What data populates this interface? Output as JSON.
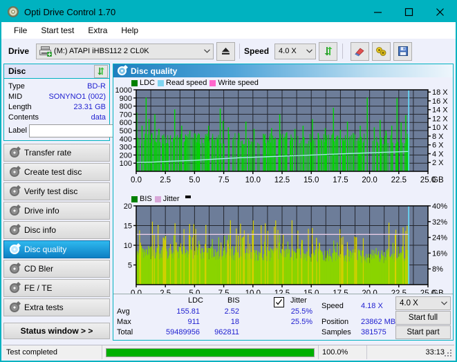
{
  "window": {
    "title": "Opti Drive Control 1.70",
    "icon": "disc-icon",
    "minimize": "minimize-icon",
    "maximize": "maximize-icon",
    "close": "close-icon",
    "accent_color": "#00b2c0"
  },
  "menu": {
    "items": [
      {
        "label": "File"
      },
      {
        "label": "Start test"
      },
      {
        "label": "Extra"
      },
      {
        "label": "Help"
      }
    ]
  },
  "toolbar": {
    "drive_label": "Drive",
    "drive_value": "(M:)   ATAPI iHBS112  2 CL0K",
    "eject_icon": "eject-icon",
    "speed_label": "Speed",
    "speed_value": "4.0 X",
    "refresh_icon": "refresh-icon",
    "erase_icon": "eraser-icon",
    "tools_icon": "plug-icon",
    "save_icon": "floppy-save-icon"
  },
  "disc_panel": {
    "title": "Disc",
    "refresh_icon": "refresh-icon",
    "rows": [
      {
        "key": "Type",
        "value": "BD-R"
      },
      {
        "key": "MID",
        "value": "SONYNO1 (002)"
      },
      {
        "key": "Length",
        "value": "23.31 GB"
      },
      {
        "key": "Contents",
        "value": "data"
      }
    ],
    "label_key": "Label",
    "label_value": "",
    "label_placeholder": "",
    "disc_button_icon": "cd-icon"
  },
  "nav": {
    "items": [
      {
        "label": "Transfer rate",
        "active": false
      },
      {
        "label": "Create test disc",
        "active": false
      },
      {
        "label": "Verify test disc",
        "active": false
      },
      {
        "label": "Drive info",
        "active": false
      },
      {
        "label": "Disc info",
        "active": false
      },
      {
        "label": "Disc quality",
        "active": true
      },
      {
        "label": "CD Bler",
        "active": false
      },
      {
        "label": "FE / TE",
        "active": false
      },
      {
        "label": "Extra tests",
        "active": false
      }
    ],
    "status_window": "Status window > >"
  },
  "panel": {
    "title": "Disc quality",
    "icon": "disc-quality-icon"
  },
  "chart_data": [
    {
      "type": "area",
      "id": "ldc-chart",
      "title": "",
      "legend": [
        {
          "label": "LDC",
          "color": "#008000"
        },
        {
          "label": "Read speed",
          "color": "#7fd4f0"
        },
        {
          "label": "Write speed",
          "color": "#ff66cc"
        }
      ],
      "legend_position": "top-left",
      "xlabel": "GB",
      "x_ticks": [
        "0.0",
        "2.5",
        "5.0",
        "7.5",
        "10.0",
        "12.5",
        "15.0",
        "17.5",
        "20.0",
        "22.5",
        "25.0"
      ],
      "xlim": [
        0,
        25
      ],
      "ylabel_left": "",
      "y_ticks_left": [
        "1000",
        "900",
        "800",
        "700",
        "600",
        "500",
        "400",
        "300",
        "200",
        "100"
      ],
      "ylim_left": [
        0,
        1000
      ],
      "ylabel_right": "",
      "y_ticks_right": [
        "18 X",
        "16 X",
        "14 X",
        "12 X",
        "10 X",
        "8 X",
        "6 X",
        "4 X",
        "2 X"
      ],
      "ylim_right": [
        0,
        18.5
      ],
      "grid": true,
      "plot_bg": "#6d7d99",
      "data_end_x": 23.4,
      "series": [
        {
          "name": "LDC",
          "color": "#00d400",
          "type": "area",
          "baseline_values": [
            400,
            390,
            350,
            330,
            320,
            310,
            305,
            300,
            300,
            298,
            296,
            295,
            292,
            290,
            290,
            288,
            288,
            287,
            286,
            286,
            285,
            286,
            287,
            288,
            289,
            290,
            291,
            292,
            293,
            294,
            295,
            296,
            297,
            298,
            299,
            300,
            301,
            302,
            303,
            305,
            307,
            309,
            311,
            313,
            315,
            317,
            319,
            321,
            323,
            325
          ],
          "peaks": [
            {
              "x": 0.05,
              "y": 720
            },
            {
              "x": 0.5,
              "y": 560
            },
            {
              "x": 0.85,
              "y": 905
            },
            {
              "x": 1.1,
              "y": 640
            },
            {
              "x": 1.35,
              "y": 470
            },
            {
              "x": 1.6,
              "y": 700
            },
            {
              "x": 1.95,
              "y": 520
            },
            {
              "x": 2.25,
              "y": 440
            },
            {
              "x": 3.3,
              "y": 760
            },
            {
              "x": 3.9,
              "y": 560
            },
            {
              "x": 4.6,
              "y": 500
            },
            {
              "x": 5.4,
              "y": 455
            },
            {
              "x": 6.2,
              "y": 560
            },
            {
              "x": 6.55,
              "y": 430
            },
            {
              "x": 7.2,
              "y": 770
            },
            {
              "x": 7.45,
              "y": 620
            },
            {
              "x": 7.9,
              "y": 540
            },
            {
              "x": 8.8,
              "y": 470
            },
            {
              "x": 9.4,
              "y": 610
            },
            {
              "x": 10.1,
              "y": 520
            },
            {
              "x": 10.9,
              "y": 460
            },
            {
              "x": 11.6,
              "y": 530
            },
            {
              "x": 12.3,
              "y": 700
            },
            {
              "x": 12.9,
              "y": 480
            },
            {
              "x": 13.6,
              "y": 520
            },
            {
              "x": 14.3,
              "y": 560
            },
            {
              "x": 15.1,
              "y": 640
            },
            {
              "x": 15.6,
              "y": 470
            },
            {
              "x": 16.2,
              "y": 530
            },
            {
              "x": 16.9,
              "y": 780
            },
            {
              "x": 17.5,
              "y": 510
            },
            {
              "x": 18.1,
              "y": 610
            },
            {
              "x": 18.6,
              "y": 470
            },
            {
              "x": 19.2,
              "y": 560
            },
            {
              "x": 19.8,
              "y": 905
            },
            {
              "x": 20.4,
              "y": 540
            },
            {
              "x": 20.9,
              "y": 630
            },
            {
              "x": 21.4,
              "y": 500
            },
            {
              "x": 21.9,
              "y": 560
            },
            {
              "x": 22.35,
              "y": 900
            },
            {
              "x": 22.7,
              "y": 600
            },
            {
              "x": 23.1,
              "y": 690
            }
          ]
        },
        {
          "name": "Read speed",
          "color": "#9ff0e0",
          "type": "line",
          "points": [
            [
              0.0,
              2.0
            ],
            [
              1.5,
              2.1
            ],
            [
              3.0,
              2.3
            ],
            [
              5.0,
              2.5
            ],
            [
              7.0,
              2.8
            ],
            [
              9.0,
              3.1
            ],
            [
              11.0,
              3.3
            ],
            [
              13.0,
              3.5
            ],
            [
              15.0,
              3.7
            ],
            [
              17.0,
              3.9
            ],
            [
              19.0,
              4.1
            ],
            [
              21.0,
              4.3
            ],
            [
              23.3,
              4.5
            ]
          ]
        },
        {
          "name": "Write speed",
          "color": "#ff66cc",
          "type": "line",
          "points": []
        }
      ],
      "cursor_line": {
        "x": 23.35,
        "color": "#66e0ff"
      }
    },
    {
      "type": "bar",
      "id": "bis-jitter-chart",
      "title": "",
      "legend": [
        {
          "label": "BIS",
          "color": "#008000"
        },
        {
          "label": "Jitter",
          "color": "#d8a8d8"
        }
      ],
      "legend_position": "top-left",
      "xlabel": "GB",
      "x_ticks": [
        "0.0",
        "2.5",
        "5.0",
        "7.5",
        "10.0",
        "12.5",
        "15.0",
        "17.5",
        "20.0",
        "22.5",
        "25.0"
      ],
      "xlim": [
        0,
        25
      ],
      "y_ticks_left": [
        "20",
        "15",
        "10",
        "5"
      ],
      "ylim_left": [
        0,
        20
      ],
      "y_ticks_right": [
        "40%",
        "32%",
        "24%",
        "16%",
        "8%"
      ],
      "ylim_right": [
        0,
        40
      ],
      "grid": true,
      "plot_bg": "#6d7d99",
      "data_end_x": 23.4,
      "series": [
        {
          "name": "BIS",
          "color": "#7fd000",
          "type": "bar",
          "avg_level": 9.5,
          "max_level": 16
        },
        {
          "name": "Jitter",
          "color": "#e8d0e8",
          "type": "line",
          "level_pct": 25.5
        }
      ],
      "cursor_line": {
        "x": 23.35,
        "color": "#66e0ff"
      }
    }
  ],
  "stats": {
    "col_headers": [
      "LDC",
      "BIS"
    ],
    "row_headers": [
      "Avg",
      "Max",
      "Total"
    ],
    "ldc": {
      "avg": "155.81",
      "max": "911",
      "total": "59489956"
    },
    "bis": {
      "avg": "2.52",
      "max": "18",
      "total": "962811"
    },
    "jitter": {
      "label": "Jitter",
      "checked": true,
      "avg": "25.5%",
      "max": "25.5%"
    },
    "speed_label": "Speed",
    "speed_value": "4.18 X",
    "position_label": "Position",
    "position_value": "23862 MB",
    "samples_label": "Samples",
    "samples_value": "381575",
    "speed_select": "4.0 X",
    "start_full": "Start full",
    "start_part": "Start part"
  },
  "statusbar": {
    "message": "Test completed",
    "progress_pct": 100.0,
    "progress_text": "100.0%",
    "elapsed": "33:13",
    "progress_color": "#00b000"
  }
}
